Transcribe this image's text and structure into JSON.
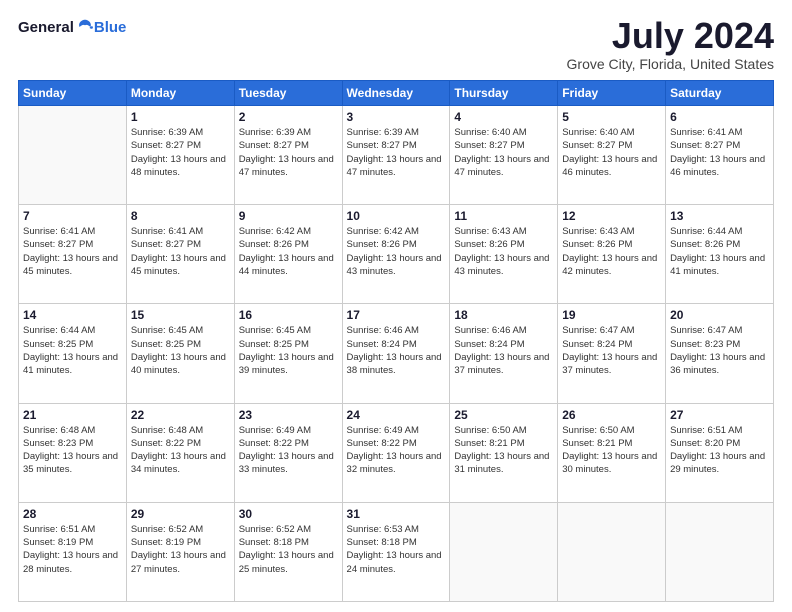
{
  "header": {
    "logo_general": "General",
    "logo_blue": "Blue",
    "month_title": "July 2024",
    "location": "Grove City, Florida, United States"
  },
  "weekdays": [
    "Sunday",
    "Monday",
    "Tuesday",
    "Wednesday",
    "Thursday",
    "Friday",
    "Saturday"
  ],
  "weeks": [
    [
      {
        "day": "",
        "sunrise": "",
        "sunset": "",
        "daylight": ""
      },
      {
        "day": "1",
        "sunrise": "Sunrise: 6:39 AM",
        "sunset": "Sunset: 8:27 PM",
        "daylight": "Daylight: 13 hours and 48 minutes."
      },
      {
        "day": "2",
        "sunrise": "Sunrise: 6:39 AM",
        "sunset": "Sunset: 8:27 PM",
        "daylight": "Daylight: 13 hours and 47 minutes."
      },
      {
        "day": "3",
        "sunrise": "Sunrise: 6:39 AM",
        "sunset": "Sunset: 8:27 PM",
        "daylight": "Daylight: 13 hours and 47 minutes."
      },
      {
        "day": "4",
        "sunrise": "Sunrise: 6:40 AM",
        "sunset": "Sunset: 8:27 PM",
        "daylight": "Daylight: 13 hours and 47 minutes."
      },
      {
        "day": "5",
        "sunrise": "Sunrise: 6:40 AM",
        "sunset": "Sunset: 8:27 PM",
        "daylight": "Daylight: 13 hours and 46 minutes."
      },
      {
        "day": "6",
        "sunrise": "Sunrise: 6:41 AM",
        "sunset": "Sunset: 8:27 PM",
        "daylight": "Daylight: 13 hours and 46 minutes."
      }
    ],
    [
      {
        "day": "7",
        "sunrise": "Sunrise: 6:41 AM",
        "sunset": "Sunset: 8:27 PM",
        "daylight": "Daylight: 13 hours and 45 minutes."
      },
      {
        "day": "8",
        "sunrise": "Sunrise: 6:41 AM",
        "sunset": "Sunset: 8:27 PM",
        "daylight": "Daylight: 13 hours and 45 minutes."
      },
      {
        "day": "9",
        "sunrise": "Sunrise: 6:42 AM",
        "sunset": "Sunset: 8:26 PM",
        "daylight": "Daylight: 13 hours and 44 minutes."
      },
      {
        "day": "10",
        "sunrise": "Sunrise: 6:42 AM",
        "sunset": "Sunset: 8:26 PM",
        "daylight": "Daylight: 13 hours and 43 minutes."
      },
      {
        "day": "11",
        "sunrise": "Sunrise: 6:43 AM",
        "sunset": "Sunset: 8:26 PM",
        "daylight": "Daylight: 13 hours and 43 minutes."
      },
      {
        "day": "12",
        "sunrise": "Sunrise: 6:43 AM",
        "sunset": "Sunset: 8:26 PM",
        "daylight": "Daylight: 13 hours and 42 minutes."
      },
      {
        "day": "13",
        "sunrise": "Sunrise: 6:44 AM",
        "sunset": "Sunset: 8:26 PM",
        "daylight": "Daylight: 13 hours and 41 minutes."
      }
    ],
    [
      {
        "day": "14",
        "sunrise": "Sunrise: 6:44 AM",
        "sunset": "Sunset: 8:25 PM",
        "daylight": "Daylight: 13 hours and 41 minutes."
      },
      {
        "day": "15",
        "sunrise": "Sunrise: 6:45 AM",
        "sunset": "Sunset: 8:25 PM",
        "daylight": "Daylight: 13 hours and 40 minutes."
      },
      {
        "day": "16",
        "sunrise": "Sunrise: 6:45 AM",
        "sunset": "Sunset: 8:25 PM",
        "daylight": "Daylight: 13 hours and 39 minutes."
      },
      {
        "day": "17",
        "sunrise": "Sunrise: 6:46 AM",
        "sunset": "Sunset: 8:24 PM",
        "daylight": "Daylight: 13 hours and 38 minutes."
      },
      {
        "day": "18",
        "sunrise": "Sunrise: 6:46 AM",
        "sunset": "Sunset: 8:24 PM",
        "daylight": "Daylight: 13 hours and 37 minutes."
      },
      {
        "day": "19",
        "sunrise": "Sunrise: 6:47 AM",
        "sunset": "Sunset: 8:24 PM",
        "daylight": "Daylight: 13 hours and 37 minutes."
      },
      {
        "day": "20",
        "sunrise": "Sunrise: 6:47 AM",
        "sunset": "Sunset: 8:23 PM",
        "daylight": "Daylight: 13 hours and 36 minutes."
      }
    ],
    [
      {
        "day": "21",
        "sunrise": "Sunrise: 6:48 AM",
        "sunset": "Sunset: 8:23 PM",
        "daylight": "Daylight: 13 hours and 35 minutes."
      },
      {
        "day": "22",
        "sunrise": "Sunrise: 6:48 AM",
        "sunset": "Sunset: 8:22 PM",
        "daylight": "Daylight: 13 hours and 34 minutes."
      },
      {
        "day": "23",
        "sunrise": "Sunrise: 6:49 AM",
        "sunset": "Sunset: 8:22 PM",
        "daylight": "Daylight: 13 hours and 33 minutes."
      },
      {
        "day": "24",
        "sunrise": "Sunrise: 6:49 AM",
        "sunset": "Sunset: 8:22 PM",
        "daylight": "Daylight: 13 hours and 32 minutes."
      },
      {
        "day": "25",
        "sunrise": "Sunrise: 6:50 AM",
        "sunset": "Sunset: 8:21 PM",
        "daylight": "Daylight: 13 hours and 31 minutes."
      },
      {
        "day": "26",
        "sunrise": "Sunrise: 6:50 AM",
        "sunset": "Sunset: 8:21 PM",
        "daylight": "Daylight: 13 hours and 30 minutes."
      },
      {
        "day": "27",
        "sunrise": "Sunrise: 6:51 AM",
        "sunset": "Sunset: 8:20 PM",
        "daylight": "Daylight: 13 hours and 29 minutes."
      }
    ],
    [
      {
        "day": "28",
        "sunrise": "Sunrise: 6:51 AM",
        "sunset": "Sunset: 8:19 PM",
        "daylight": "Daylight: 13 hours and 28 minutes."
      },
      {
        "day": "29",
        "sunrise": "Sunrise: 6:52 AM",
        "sunset": "Sunset: 8:19 PM",
        "daylight": "Daylight: 13 hours and 27 minutes."
      },
      {
        "day": "30",
        "sunrise": "Sunrise: 6:52 AM",
        "sunset": "Sunset: 8:18 PM",
        "daylight": "Daylight: 13 hours and 25 minutes."
      },
      {
        "day": "31",
        "sunrise": "Sunrise: 6:53 AM",
        "sunset": "Sunset: 8:18 PM",
        "daylight": "Daylight: 13 hours and 24 minutes."
      },
      {
        "day": "",
        "sunrise": "",
        "sunset": "",
        "daylight": ""
      },
      {
        "day": "",
        "sunrise": "",
        "sunset": "",
        "daylight": ""
      },
      {
        "day": "",
        "sunrise": "",
        "sunset": "",
        "daylight": ""
      }
    ]
  ]
}
